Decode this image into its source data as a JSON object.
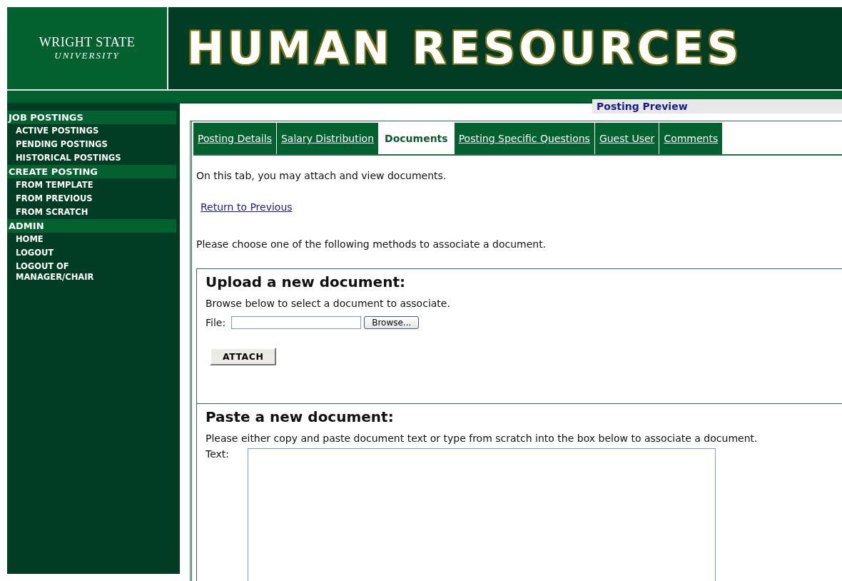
{
  "header": {
    "logo_line1": "WRIGHT STATE",
    "logo_line2": "UNIVERSITY",
    "title": "HUMAN RESOURCES"
  },
  "sidebar": {
    "sections": [
      {
        "title": "JOB POSTINGS",
        "items": [
          "ACTIVE POSTINGS",
          "PENDING POSTINGS",
          "HISTORICAL POSTINGS"
        ]
      },
      {
        "title": "CREATE POSTING",
        "items": [
          "FROM TEMPLATE",
          "FROM PREVIOUS",
          "FROM SCRATCH"
        ]
      },
      {
        "title": "ADMIN",
        "items": [
          "HOME",
          "LOGOUT",
          "LOGOUT OF MANAGER/CHAIR"
        ]
      }
    ]
  },
  "preview_link": "Posting Preview",
  "tabs": [
    {
      "label": "Posting Details",
      "selected": false
    },
    {
      "label": "Salary Distribution",
      "selected": false
    },
    {
      "label": "Documents",
      "selected": true
    },
    {
      "label": "Posting Specific Questions",
      "selected": false
    },
    {
      "label": "Guest User",
      "selected": false
    },
    {
      "label": "Comments",
      "selected": false
    }
  ],
  "intro": "On this tab, you may attach and view documents.",
  "return_link": "Return to Previous",
  "instruction": "Please choose one of the following methods to associate a document.",
  "upload": {
    "heading": "Upload a new document:",
    "hint": "Browse below to select a document to associate.",
    "file_label": "File:",
    "browse_button": "Browse...",
    "attach_button": "ATTACH"
  },
  "paste": {
    "heading": "Paste a new document:",
    "hint": "Please either copy and paste document text or type from scratch into the box below to associate a document.",
    "text_label": "Text:"
  }
}
